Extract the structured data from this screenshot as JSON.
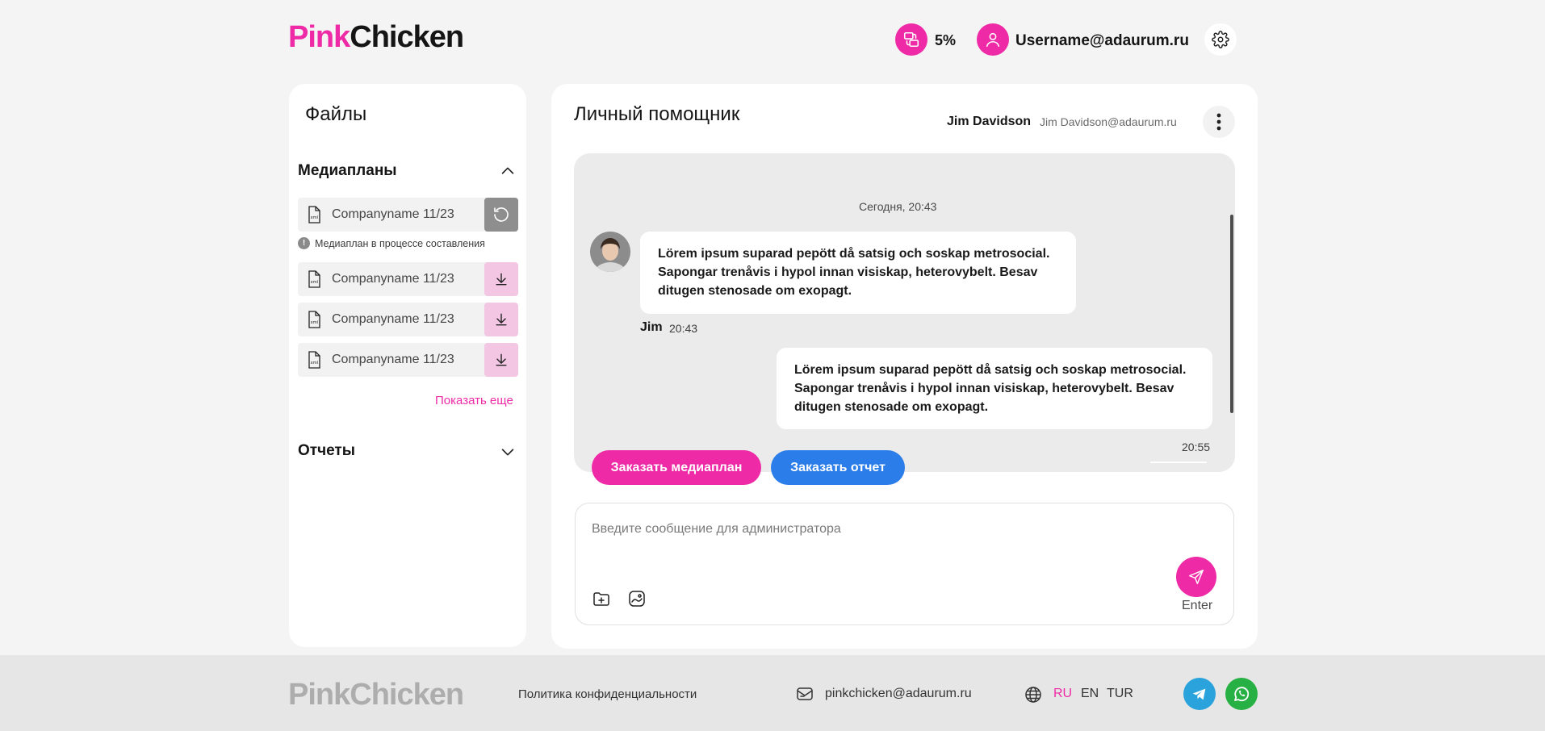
{
  "header": {
    "logo_part1": "Pink",
    "logo_part2": "Chicken",
    "progress": "5%",
    "username": "Username@adaurum.ru"
  },
  "files": {
    "title": "Файлы",
    "media_section": "Медиапланы",
    "items": [
      {
        "name": "Companyname 11/23",
        "action": "refresh"
      },
      {
        "name": "Companyname 11/23",
        "action": "download"
      },
      {
        "name": "Companyname 11/23",
        "action": "download"
      },
      {
        "name": "Companyname 11/23",
        "action": "download"
      }
    ],
    "status": "Медиаплан в процессе составления",
    "show_more": "Показать еще",
    "reports_section": "Отчеты"
  },
  "chat": {
    "title": "Личный помощник",
    "contact_name": "Jim Davidson",
    "contact_email": "Jim Davidson@adaurum.ru",
    "date_divider": "Сегодня, 20:43",
    "messages": [
      {
        "author": "Jim",
        "time": "20:43",
        "text": "Lörem ipsum suparad pepött då satsig och soskap metrosocial. Sapongar trenåvis i hypol innan visiskap, heterovybelt. Besav ditugen stenosade om exopagt."
      },
      {
        "author": "",
        "time": "20:55",
        "text": "Lörem ipsum suparad pepött då satsig och soskap metrosocial. Sapongar trenåvis i hypol innan visiskap, heterovybelt. Besav ditugen stenosade om exopagt."
      }
    ],
    "order_media_btn": "Заказать медиаплан",
    "order_report_btn": "Заказать отчет",
    "input_placeholder": "Введите сообщение для администратора",
    "send_hint": "Enter"
  },
  "footer": {
    "logo_part1": "Pink",
    "logo_part2": "Chicken",
    "policy": "Политика конфиденциальности",
    "email": "pinkchicken@adaurum.ru",
    "languages": [
      "RU",
      "EN",
      "TUR"
    ],
    "active_language": "RU"
  },
  "colors": {
    "accent_pink": "#ee2aa6",
    "accent_blue": "#2b7de9",
    "telegram": "#2aa3dc",
    "whatsapp": "#27b043"
  }
}
